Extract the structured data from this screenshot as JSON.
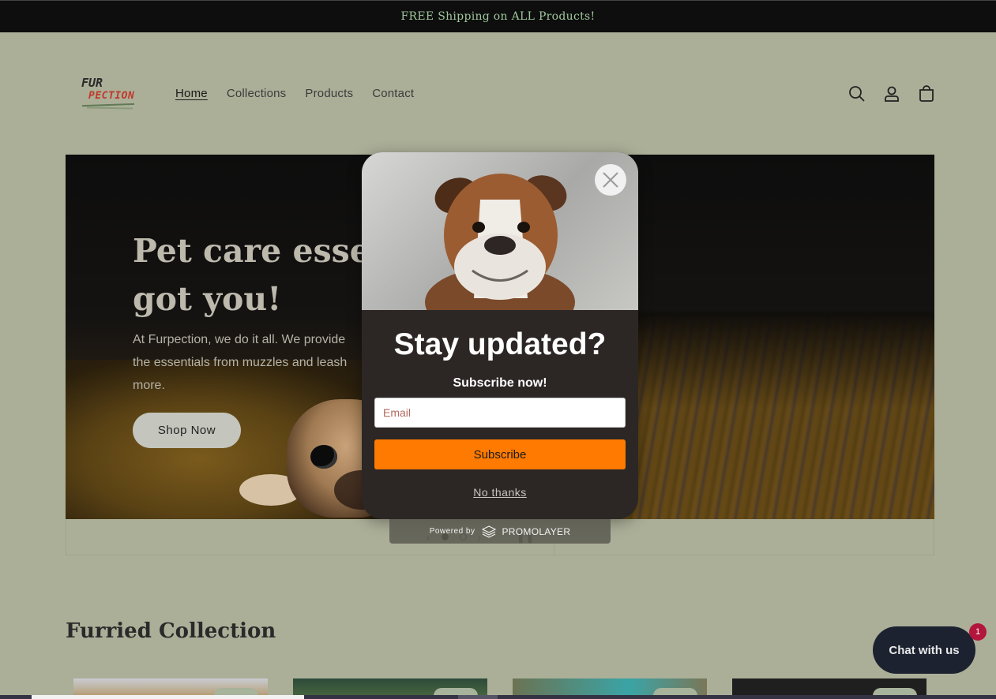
{
  "announcement": "FREE Shipping on ALL Products!",
  "logo": {
    "line1": "FUR",
    "line2": "PECTION"
  },
  "nav": [
    {
      "label": "Home",
      "active": true
    },
    {
      "label": "Collections"
    },
    {
      "label": "Products"
    },
    {
      "label": "Contact"
    }
  ],
  "header_icons": [
    "search-icon",
    "account-icon",
    "cart-icon"
  ],
  "hero": {
    "title": "Pet care essenti got you!",
    "title_line1": "Pet care essenti",
    "title_line2": "got you!",
    "text_line1": "At Furpection, we do it all. We provide",
    "text_line2": "the essentials from muzzles and leash",
    "text_line3": "more.",
    "button": "Shop Now"
  },
  "collection_title": "Furried Collection",
  "chat": {
    "label": "Chat with us",
    "badge": "1"
  },
  "popup": {
    "title": "Stay updated?",
    "subtitle": "Subscribe now!",
    "email_placeholder": "Email",
    "subscribe_label": "Subscribe",
    "no_thanks": "No thanks",
    "powered_by": "Powered by",
    "brand": "PROMOLAYER"
  },
  "colors": {
    "page_bg": "#abaf98",
    "announce_bg": "#0e0e0e",
    "announce_text": "#9fc79c",
    "subscribe_bg": "#ff7a00",
    "popup_bg": "#2c2725",
    "chat_bg": "#1c2230",
    "badge_bg": "#b3163d"
  }
}
